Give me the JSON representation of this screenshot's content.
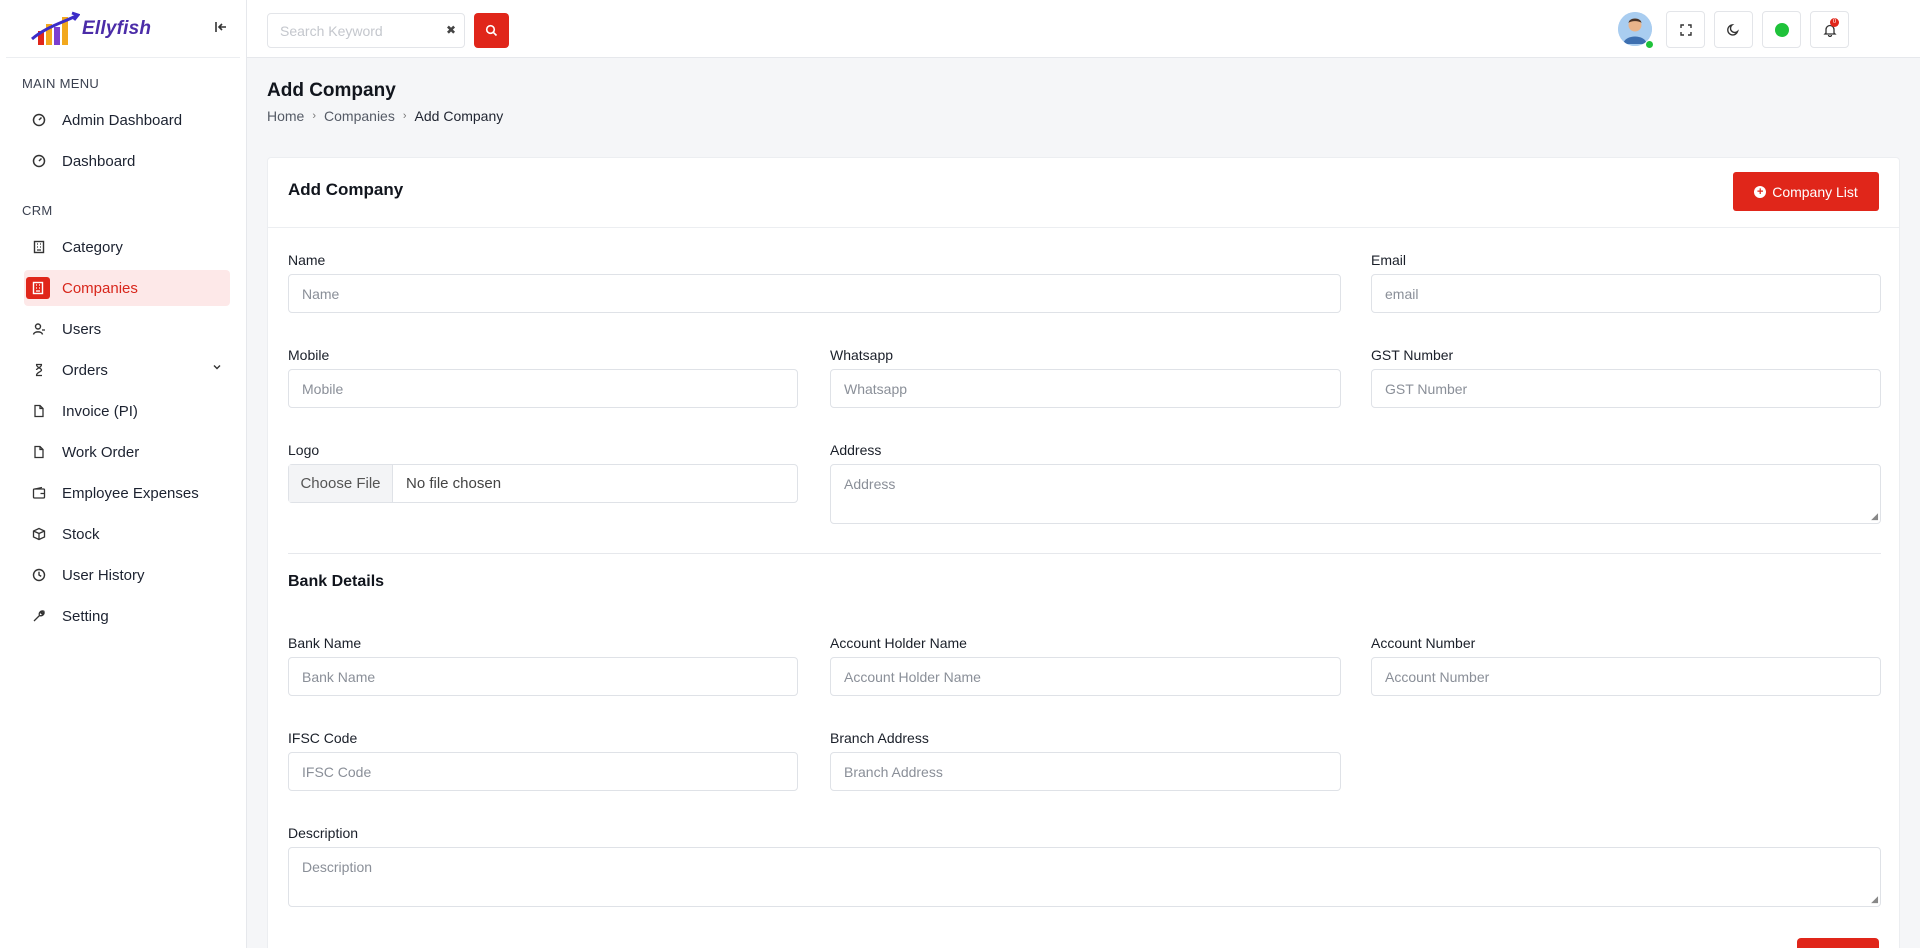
{
  "brand": {
    "name": "Ellyfish"
  },
  "sidebar": {
    "sections": [
      {
        "title": "MAIN MENU",
        "items": [
          {
            "label": "Admin Dashboard",
            "icon": "gauge-icon"
          },
          {
            "label": "Dashboard",
            "icon": "gauge-icon"
          }
        ]
      },
      {
        "title": "CRM",
        "items": [
          {
            "label": "Category",
            "icon": "building-icon"
          },
          {
            "label": "Companies",
            "icon": "building-icon",
            "active": true
          },
          {
            "label": "Users",
            "icon": "user-icon"
          },
          {
            "label": "Orders",
            "icon": "hourglass-icon",
            "expandable": true
          },
          {
            "label": "Invoice (PI)",
            "icon": "file-icon"
          },
          {
            "label": "Work Order",
            "icon": "file-icon"
          },
          {
            "label": "Employee Expenses",
            "icon": "wallet-icon"
          },
          {
            "label": "Stock",
            "icon": "box-icon"
          },
          {
            "label": "User History",
            "icon": "clock-icon"
          },
          {
            "label": "Setting",
            "icon": "wrench-icon"
          }
        ]
      }
    ]
  },
  "topbar": {
    "search_placeholder": "Search Keyword",
    "icons": [
      "fullscreen-icon",
      "moon-icon",
      "status-dot-icon",
      "bell-icon"
    ],
    "notification_count": "0"
  },
  "page": {
    "title": "Add Company",
    "breadcrumb": [
      "Home",
      "Companies",
      "Add Company"
    ]
  },
  "card": {
    "title": "Add Company",
    "list_button": "Company List",
    "fields": {
      "name": {
        "label": "Name",
        "placeholder": "Name"
      },
      "email": {
        "label": "Email",
        "placeholder": "email"
      },
      "mobile": {
        "label": "Mobile",
        "placeholder": "Mobile"
      },
      "whatsapp": {
        "label": "Whatsapp",
        "placeholder": "Whatsapp"
      },
      "gst": {
        "label": "GST Number",
        "placeholder": "GST Number"
      },
      "logo": {
        "label": "Logo",
        "button": "Choose File",
        "status": "No file chosen"
      },
      "address": {
        "label": "Address",
        "placeholder": "Address"
      }
    },
    "bank_section_title": "Bank Details",
    "bank_fields": {
      "bank_name": {
        "label": "Bank Name",
        "placeholder": "Bank Name"
      },
      "holder": {
        "label": "Account Holder Name",
        "placeholder": "Account Holder Name"
      },
      "account_number": {
        "label": "Account Number",
        "placeholder": "Account Number"
      },
      "ifsc": {
        "label": "IFSC Code",
        "placeholder": "IFSC Code"
      },
      "branch": {
        "label": "Branch Address",
        "placeholder": "Branch Address"
      },
      "description": {
        "label": "Description",
        "placeholder": "Description"
      }
    }
  },
  "colors": {
    "accent": "#e0261a",
    "active_bg": "#fde8e8",
    "online": "#1fc23a"
  }
}
